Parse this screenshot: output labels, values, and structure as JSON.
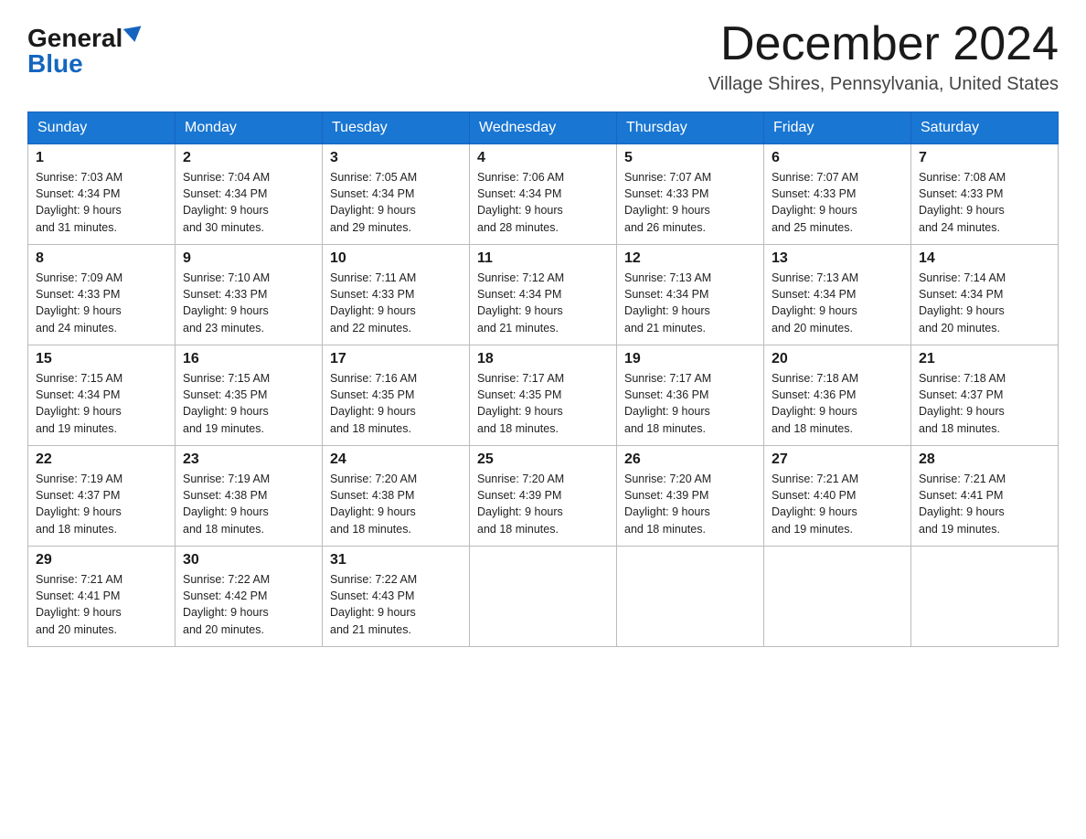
{
  "logo": {
    "general": "General",
    "blue": "Blue"
  },
  "title": "December 2024",
  "subtitle": "Village Shires, Pennsylvania, United States",
  "days_of_week": [
    "Sunday",
    "Monday",
    "Tuesday",
    "Wednesday",
    "Thursday",
    "Friday",
    "Saturday"
  ],
  "weeks": [
    [
      {
        "day": "1",
        "sunrise": "7:03 AM",
        "sunset": "4:34 PM",
        "daylight": "9 hours and 31 minutes."
      },
      {
        "day": "2",
        "sunrise": "7:04 AM",
        "sunset": "4:34 PM",
        "daylight": "9 hours and 30 minutes."
      },
      {
        "day": "3",
        "sunrise": "7:05 AM",
        "sunset": "4:34 PM",
        "daylight": "9 hours and 29 minutes."
      },
      {
        "day": "4",
        "sunrise": "7:06 AM",
        "sunset": "4:34 PM",
        "daylight": "9 hours and 28 minutes."
      },
      {
        "day": "5",
        "sunrise": "7:07 AM",
        "sunset": "4:33 PM",
        "daylight": "9 hours and 26 minutes."
      },
      {
        "day": "6",
        "sunrise": "7:07 AM",
        "sunset": "4:33 PM",
        "daylight": "9 hours and 25 minutes."
      },
      {
        "day": "7",
        "sunrise": "7:08 AM",
        "sunset": "4:33 PM",
        "daylight": "9 hours and 24 minutes."
      }
    ],
    [
      {
        "day": "8",
        "sunrise": "7:09 AM",
        "sunset": "4:33 PM",
        "daylight": "9 hours and 24 minutes."
      },
      {
        "day": "9",
        "sunrise": "7:10 AM",
        "sunset": "4:33 PM",
        "daylight": "9 hours and 23 minutes."
      },
      {
        "day": "10",
        "sunrise": "7:11 AM",
        "sunset": "4:33 PM",
        "daylight": "9 hours and 22 minutes."
      },
      {
        "day": "11",
        "sunrise": "7:12 AM",
        "sunset": "4:34 PM",
        "daylight": "9 hours and 21 minutes."
      },
      {
        "day": "12",
        "sunrise": "7:13 AM",
        "sunset": "4:34 PM",
        "daylight": "9 hours and 21 minutes."
      },
      {
        "day": "13",
        "sunrise": "7:13 AM",
        "sunset": "4:34 PM",
        "daylight": "9 hours and 20 minutes."
      },
      {
        "day": "14",
        "sunrise": "7:14 AM",
        "sunset": "4:34 PM",
        "daylight": "9 hours and 20 minutes."
      }
    ],
    [
      {
        "day": "15",
        "sunrise": "7:15 AM",
        "sunset": "4:34 PM",
        "daylight": "9 hours and 19 minutes."
      },
      {
        "day": "16",
        "sunrise": "7:15 AM",
        "sunset": "4:35 PM",
        "daylight": "9 hours and 19 minutes."
      },
      {
        "day": "17",
        "sunrise": "7:16 AM",
        "sunset": "4:35 PM",
        "daylight": "9 hours and 18 minutes."
      },
      {
        "day": "18",
        "sunrise": "7:17 AM",
        "sunset": "4:35 PM",
        "daylight": "9 hours and 18 minutes."
      },
      {
        "day": "19",
        "sunrise": "7:17 AM",
        "sunset": "4:36 PM",
        "daylight": "9 hours and 18 minutes."
      },
      {
        "day": "20",
        "sunrise": "7:18 AM",
        "sunset": "4:36 PM",
        "daylight": "9 hours and 18 minutes."
      },
      {
        "day": "21",
        "sunrise": "7:18 AM",
        "sunset": "4:37 PM",
        "daylight": "9 hours and 18 minutes."
      }
    ],
    [
      {
        "day": "22",
        "sunrise": "7:19 AM",
        "sunset": "4:37 PM",
        "daylight": "9 hours and 18 minutes."
      },
      {
        "day": "23",
        "sunrise": "7:19 AM",
        "sunset": "4:38 PM",
        "daylight": "9 hours and 18 minutes."
      },
      {
        "day": "24",
        "sunrise": "7:20 AM",
        "sunset": "4:38 PM",
        "daylight": "9 hours and 18 minutes."
      },
      {
        "day": "25",
        "sunrise": "7:20 AM",
        "sunset": "4:39 PM",
        "daylight": "9 hours and 18 minutes."
      },
      {
        "day": "26",
        "sunrise": "7:20 AM",
        "sunset": "4:39 PM",
        "daylight": "9 hours and 18 minutes."
      },
      {
        "day": "27",
        "sunrise": "7:21 AM",
        "sunset": "4:40 PM",
        "daylight": "9 hours and 19 minutes."
      },
      {
        "day": "28",
        "sunrise": "7:21 AM",
        "sunset": "4:41 PM",
        "daylight": "9 hours and 19 minutes."
      }
    ],
    [
      {
        "day": "29",
        "sunrise": "7:21 AM",
        "sunset": "4:41 PM",
        "daylight": "9 hours and 20 minutes."
      },
      {
        "day": "30",
        "sunrise": "7:22 AM",
        "sunset": "4:42 PM",
        "daylight": "9 hours and 20 minutes."
      },
      {
        "day": "31",
        "sunrise": "7:22 AM",
        "sunset": "4:43 PM",
        "daylight": "9 hours and 21 minutes."
      },
      null,
      null,
      null,
      null
    ]
  ]
}
